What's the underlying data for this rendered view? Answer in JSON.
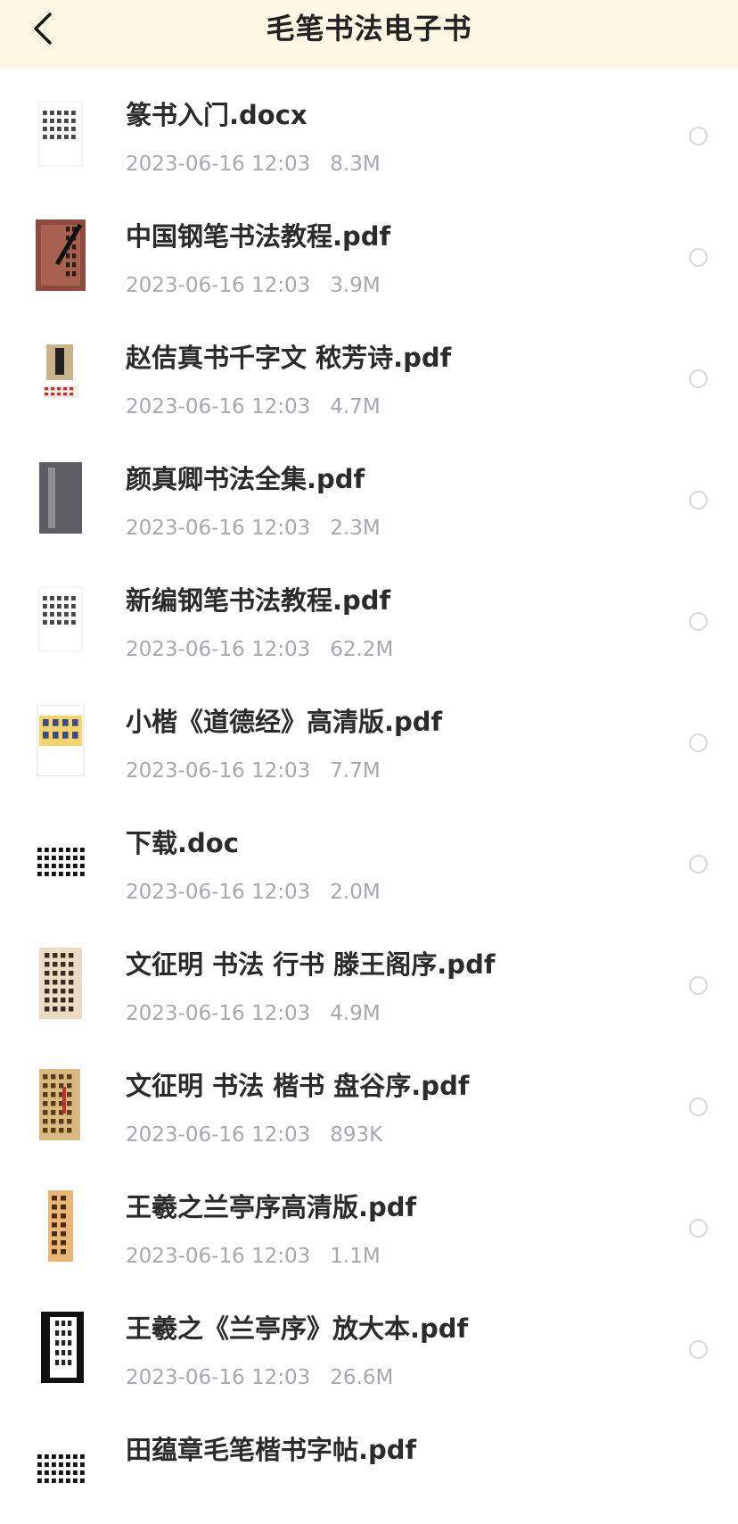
{
  "header": {
    "title": "毛笔书法电子书",
    "back_icon": "chevron-left-icon"
  },
  "files": [
    {
      "name": "篆书入门.docx",
      "date": "2023-06-16 12:03",
      "size": "8.3M",
      "thumb": "doc-text"
    },
    {
      "name": "中国钢笔书法教程.pdf",
      "date": "2023-06-16 12:03",
      "size": "3.9M",
      "thumb": "red-cover"
    },
    {
      "name": "赵佶真书千字文 秾芳诗.pdf",
      "date": "2023-06-16 12:03",
      "size": "4.7M",
      "thumb": "small-cover"
    },
    {
      "name": "颜真卿书法全集.pdf",
      "date": "2023-06-16 12:03",
      "size": "2.3M",
      "thumb": "gray-book"
    },
    {
      "name": "新编钢笔书法教程.pdf",
      "date": "2023-06-16 12:03",
      "size": "62.2M",
      "thumb": "doc-text"
    },
    {
      "name": "小楷《道德经》高清版.pdf",
      "date": "2023-06-16 12:03",
      "size": "7.7M",
      "thumb": "yellow-cover"
    },
    {
      "name": "下载.doc",
      "date": "2023-06-16 12:03",
      "size": "2.0M",
      "thumb": "black-text"
    },
    {
      "name": "文征明 书法 行书 滕王阁序.pdf",
      "date": "2023-06-16 12:03",
      "size": "4.9M",
      "thumb": "beige-scroll"
    },
    {
      "name": "文征明 书法 楷书 盘谷序.pdf",
      "date": "2023-06-16 12:03",
      "size": "893K",
      "thumb": "tan-scroll"
    },
    {
      "name": "王羲之兰亭序高清版.pdf",
      "date": "2023-06-16 12:03",
      "size": "1.1M",
      "thumb": "orange-scroll"
    },
    {
      "name": "王羲之《兰亭序》放大本.pdf",
      "date": "2023-06-16 12:03",
      "size": "26.6M",
      "thumb": "black-book"
    },
    {
      "name": "田蕴章毛笔楷书字帖.pdf",
      "date": "",
      "size": "",
      "thumb": "black-text"
    }
  ]
}
